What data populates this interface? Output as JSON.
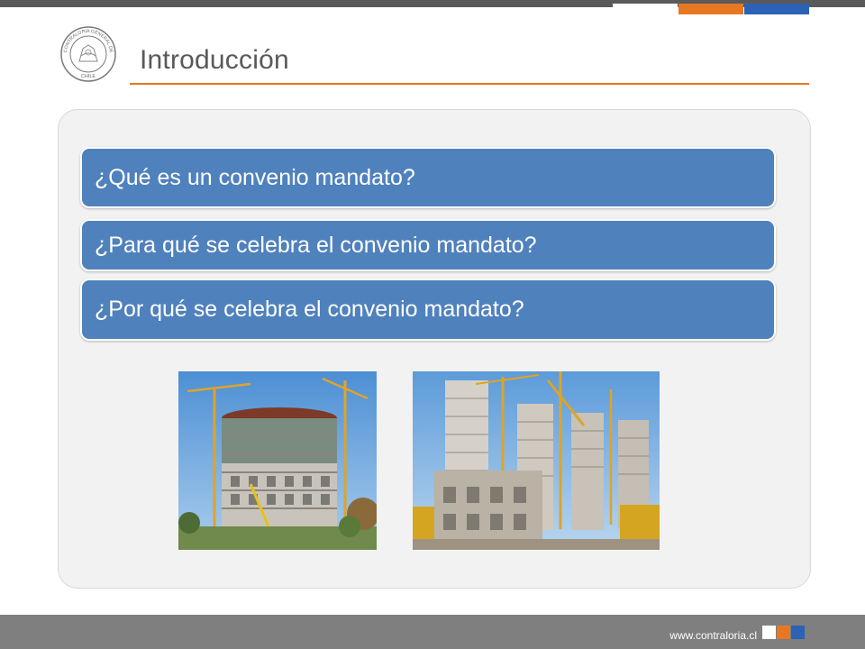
{
  "header": {
    "title": "Introducción",
    "seal_lettering": "CONTRALORIA GENERAL DE LA REPUBLICA · CHILE",
    "colors": {
      "orange": "#e87722",
      "blue": "#2c62b5",
      "gray": "#5a5a5a"
    }
  },
  "questions": [
    {
      "label": "¿Qué es un convenio mandato?"
    },
    {
      "label": "¿Para qué se celebra el convenio mandato?"
    },
    {
      "label": "¿Por qué se celebra el convenio mandato?"
    }
  ],
  "box_color": "#4f81bd",
  "photos": [
    {
      "icon": "construction-photo-round-building"
    },
    {
      "icon": "construction-photo-towers"
    }
  ],
  "footer": {
    "url": "www.contraloria.cl"
  }
}
